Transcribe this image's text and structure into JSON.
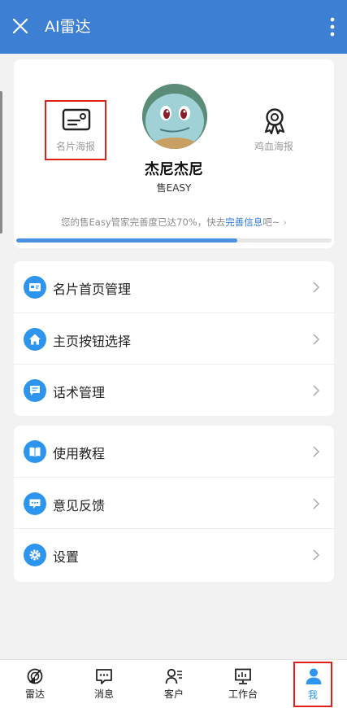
{
  "header": {
    "title": "AI雷达"
  },
  "profile": {
    "poster_label": "名片海报",
    "blood_poster_label": "鸡血海报",
    "name": "杰尼杰尼",
    "company": "售EASY",
    "progress_prefix": "您的售Easy管家完善度已达70%，快去",
    "progress_link": "完善信息",
    "progress_suffix": "吧~",
    "progress_chevron": "›",
    "progress_fraction": 0.7
  },
  "menu_group_1": [
    {
      "label": "名片首页管理",
      "icon": "card-icon"
    },
    {
      "label": "主页按钮选择",
      "icon": "home-icon"
    },
    {
      "label": "话术管理",
      "icon": "chat-script-icon"
    }
  ],
  "menu_group_2": [
    {
      "label": "使用教程",
      "icon": "book-icon"
    },
    {
      "label": "意见反馈",
      "icon": "feedback-icon"
    },
    {
      "label": "设置",
      "icon": "settings-icon"
    }
  ],
  "bottom_nav": [
    {
      "label": "雷达",
      "icon": "radar-icon"
    },
    {
      "label": "消息",
      "icon": "message-icon"
    },
    {
      "label": "客户",
      "icon": "customer-icon"
    },
    {
      "label": "工作台",
      "icon": "workbench-icon"
    },
    {
      "label": "我",
      "icon": "me-icon",
      "active": true
    }
  ],
  "colors": {
    "header_bg": "#3c7fd3",
    "accent": "#2e95ee",
    "highlight_border": "#e0201c"
  }
}
